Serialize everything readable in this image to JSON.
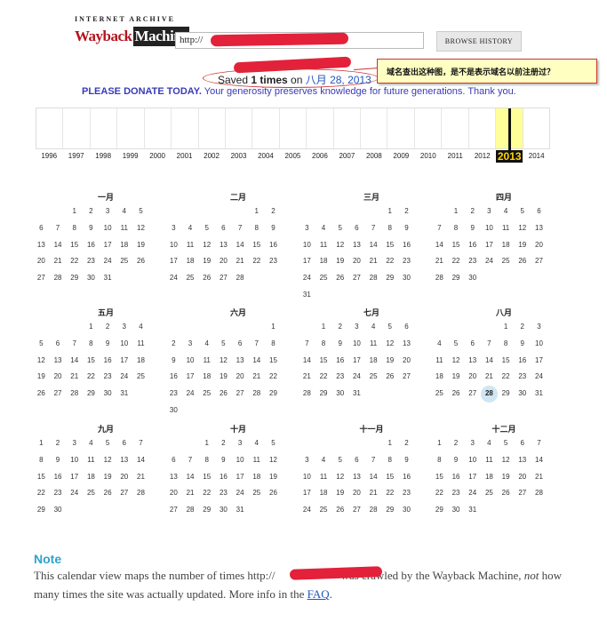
{
  "logo": {
    "top": "INTERNET ARCHIVE",
    "wayback": "Wayback",
    "machine": "Machine"
  },
  "search": {
    "url_value": "http://",
    "browse_button": "BROWSE HISTORY"
  },
  "annotation": {
    "callout_text": "域名查出这种图，是不是表示域名以前注册过？"
  },
  "saved": {
    "prefix": "Saved ",
    "count": "1 times",
    "on": " on ",
    "date": "八月 28, 2013"
  },
  "donate": {
    "bold": "PLEASE DONATE TODAY.",
    "text": " Your generosity preserves knowledge for future generations. Thank you."
  },
  "histogram": {
    "years": [
      "1996",
      "1997",
      "1998",
      "1999",
      "2000",
      "2001",
      "2002",
      "2003",
      "2004",
      "2005",
      "2006",
      "2007",
      "2008",
      "2009",
      "2010",
      "2011",
      "2012",
      "2013",
      "2014"
    ],
    "selected_year": "2013",
    "highlight_color": "#ffff99"
  },
  "calendar": {
    "months": [
      {
        "name": "一月",
        "offset": 2,
        "days": 31
      },
      {
        "name": "二月",
        "offset": 5,
        "days": 28
      },
      {
        "name": "三月",
        "offset": 5,
        "days": 31
      },
      {
        "name": "四月",
        "offset": 1,
        "days": 30
      },
      {
        "name": "五月",
        "offset": 3,
        "days": 31
      },
      {
        "name": "六月",
        "offset": 6,
        "days": 30
      },
      {
        "name": "七月",
        "offset": 1,
        "days": 31
      },
      {
        "name": "八月",
        "offset": 4,
        "days": 31,
        "highlight": 28
      },
      {
        "name": "九月",
        "offset": 0,
        "days": 30
      },
      {
        "name": "十月",
        "offset": 2,
        "days": 31
      },
      {
        "name": "十一月",
        "offset": 5,
        "days": 30
      },
      {
        "name": "十二月",
        "offset": 0,
        "days": 31
      }
    ]
  },
  "note": {
    "heading": "Note",
    "part1": "This calendar view maps the number of times http://",
    "part2": "was crawled by the Wayback Machine, ",
    "not": "not",
    "part3": " how many times the site was actually updated. More info in the ",
    "faq": "FAQ",
    "end": "."
  },
  "colors": {
    "redaction": "#e3213a",
    "note_heading": "#2ea3c9",
    "link": "#2255bb",
    "donate": "#3a3ab8"
  }
}
